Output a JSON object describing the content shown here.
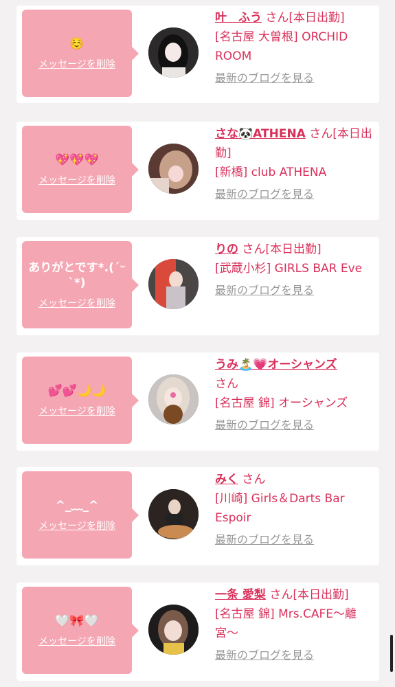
{
  "delete_label": "メッセージを削除",
  "blog_label": "最新のブログを見る",
  "cards": [
    {
      "message": "☺️",
      "name": "叶　ふう",
      "san": "さん",
      "status": "[本日出勤]",
      "shop": "[名古屋 大曽根] ORCHID ROOM"
    },
    {
      "message": "💖💖💖",
      "name": "さな🐼ATHENA",
      "san": "さん",
      "status": "[本日出勤]",
      "shop": "[新橋] club ATHENA"
    },
    {
      "message": "ありがとです*.(ˊᵕˋ*)",
      "name": "りの",
      "san": "さん",
      "status": "[本日出勤]",
      "shop": "[武蔵小杉] GIRLS BAR Eve"
    },
    {
      "message": "💕💕🌙🌙",
      "name": "うみ🏝️💗オーシャンズ",
      "san": "さん",
      "status": "",
      "shop": "[名古屋 錦] オーシャンズ"
    },
    {
      "message": "^_﹏_^",
      "name": "みく",
      "san": "さん",
      "status": "",
      "shop": "[川崎] Girls＆Darts Bar Espoir"
    },
    {
      "message": "🤍🎀🤍",
      "name": "一条 愛梨",
      "san": "さん",
      "status": "[本日出勤]",
      "shop": "[名古屋 錦] Mrs.CAFE〜離宮〜"
    }
  ]
}
